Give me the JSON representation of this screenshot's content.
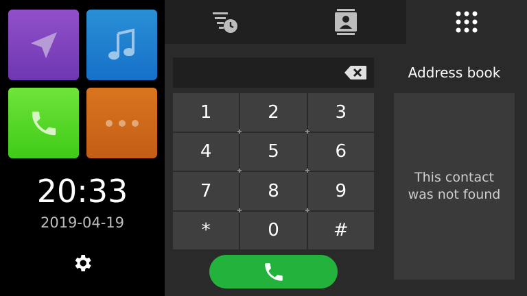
{
  "launcher": {
    "tiles": [
      {
        "name": "navigation",
        "icon": "navigation-arrow-icon",
        "color": "#7f43bf"
      },
      {
        "name": "music",
        "icon": "music-note-icon",
        "color": "#1f80cf"
      },
      {
        "name": "phone",
        "icon": "phone-icon",
        "color": "#55d628"
      },
      {
        "name": "more",
        "icon": "more-dots-icon",
        "color": "#cf6a1a"
      }
    ],
    "time": "20:33",
    "date": "2019-04-19",
    "settings_icon": "gear-icon"
  },
  "phone": {
    "tabs": [
      {
        "icon": "call-history-icon",
        "active": false
      },
      {
        "icon": "contacts-icon",
        "active": false
      },
      {
        "icon": "dialpad-icon",
        "active": true
      }
    ],
    "dial_input": "",
    "keys": [
      "1",
      "2",
      "3",
      "4",
      "5",
      "6",
      "7",
      "8",
      "9",
      "*",
      "0",
      "#"
    ],
    "call_button_color": "#23b33c",
    "address_book": {
      "title": "Address book",
      "message": "This contact was not found"
    }
  }
}
